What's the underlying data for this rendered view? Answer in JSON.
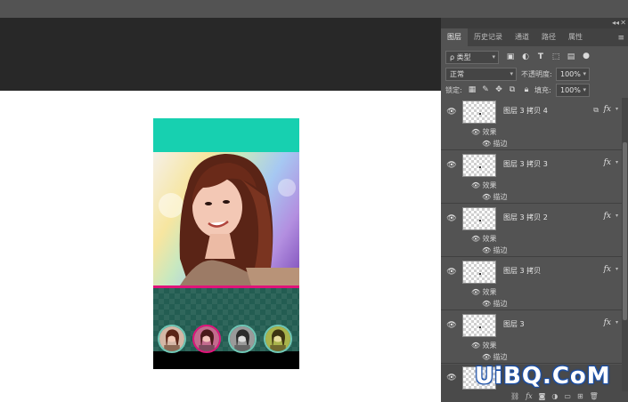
{
  "colors": {
    "header_teal": "#17d0b0",
    "accent_line": "#e0137a",
    "thumb_borders": [
      "#6fc7b6",
      "#e0137a",
      "#6fc7b6",
      "#6fc7b6"
    ]
  },
  "tabs": [
    {
      "label": "图层",
      "active": true
    },
    {
      "label": "历史记录",
      "active": false
    },
    {
      "label": "通道",
      "active": false
    },
    {
      "label": "路径",
      "active": false
    },
    {
      "label": "属性",
      "active": false
    }
  ],
  "filter": {
    "kind_label": "ρ 类型",
    "icons": [
      "image-filter-icon",
      "adjustment-filter-icon",
      "text-filter-icon",
      "shape-filter-icon",
      "smart-object-filter-icon",
      "filter-toggle-icon"
    ]
  },
  "blend": {
    "mode": "正常",
    "opacity_label": "不透明度:",
    "opacity_value": "100%"
  },
  "lock": {
    "label": "锁定:",
    "icons": [
      "lock-transparent-icon",
      "lock-image-icon",
      "lock-position-icon",
      "lock-artboard-icon",
      "lock-all-icon"
    ],
    "fill_label": "填充:",
    "fill_value": "100%"
  },
  "layers": [
    {
      "name": "图层 3 拷贝 4",
      "fx": "fx",
      "effects_label": "效果",
      "stroke_label": "描边",
      "linked": true
    },
    {
      "name": "图层 3 拷贝 3",
      "fx": "fx",
      "effects_label": "效果",
      "stroke_label": "描边",
      "linked": false
    },
    {
      "name": "图层 3 拷贝 2",
      "fx": "fx",
      "effects_label": "效果",
      "stroke_label": "描边",
      "linked": false
    },
    {
      "name": "图层 3 拷贝",
      "fx": "fx",
      "effects_label": "效果",
      "stroke_label": "描边",
      "linked": false
    },
    {
      "name": "图层 3",
      "fx": "fx",
      "effects_label": "效果",
      "stroke_label": "描边",
      "linked": false
    }
  ],
  "footer": {
    "icons": [
      "link-layers-icon",
      "add-style-icon",
      "add-mask-icon",
      "new-adjustment-icon",
      "new-group-icon",
      "new-layer-icon",
      "delete-icon"
    ]
  },
  "watermark": "UiBQ.CoM"
}
